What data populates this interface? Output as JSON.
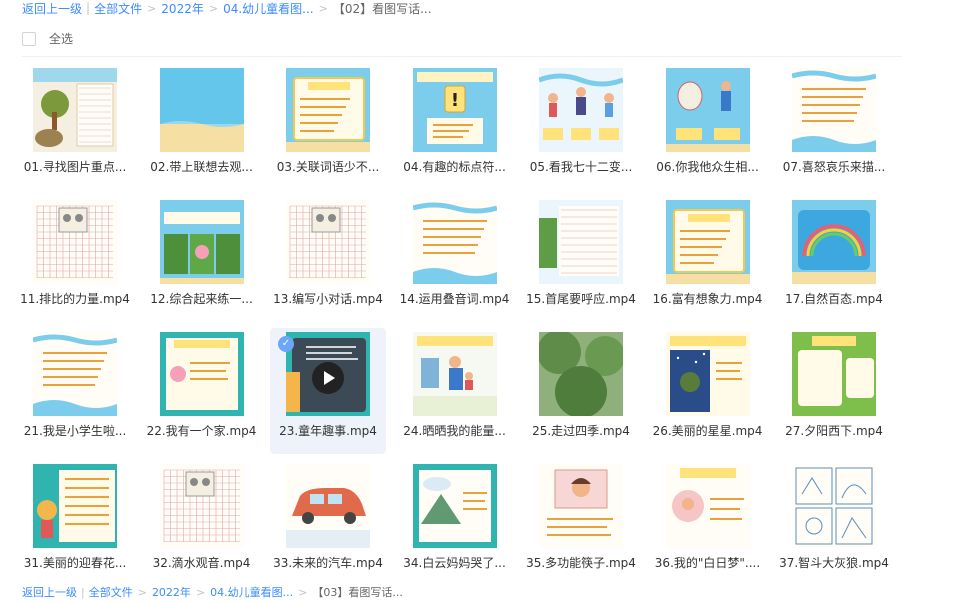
{
  "breadcrumb_top": {
    "back": "返回上一级",
    "items": [
      "全部文件",
      "2022年",
      "04.幼儿童看图..."
    ],
    "current": "【02】看图写话..."
  },
  "select_all_label": "全选",
  "files": [
    {
      "name": "01.寻找图片重点...",
      "thumb": "tree-rock"
    },
    {
      "name": "02.带上联想去观...",
      "thumb": "sea-beach"
    },
    {
      "name": "03.关联词语少不...",
      "thumb": "text-card"
    },
    {
      "name": "04.有趣的标点符...",
      "thumb": "exclaim"
    },
    {
      "name": "05.看我七十二变...",
      "thumb": "dancers"
    },
    {
      "name": "06.你我他众生相...",
      "thumb": "figures"
    },
    {
      "name": "07.喜怒哀乐来描...",
      "thumb": "text-sea"
    },
    {
      "name": "11.排比的力量.mp4",
      "thumb": "grid-writing"
    },
    {
      "name": "12.综合起来练一...",
      "thumb": "lotus"
    },
    {
      "name": "13.编写小对话.mp4",
      "thumb": "grid-writing"
    },
    {
      "name": "14.运用叠音词.mp4",
      "thumb": "text-sea"
    },
    {
      "name": "15.首尾要呼应.mp4",
      "thumb": "text-green"
    },
    {
      "name": "16.富有想象力.mp4",
      "thumb": "text-card"
    },
    {
      "name": "17.自然百态.mp4",
      "thumb": "rainbow"
    },
    {
      "name": "21.我是小学生啦...",
      "thumb": "text-sea"
    },
    {
      "name": "22.我有一个家.mp4",
      "thumb": "card-green"
    },
    {
      "name": "23.童年趣事.mp4",
      "thumb": "dark-card"
    },
    {
      "name": "24.晒晒我的能量...",
      "thumb": "family"
    },
    {
      "name": "25.走过四季.mp4",
      "thumb": "nature"
    },
    {
      "name": "26.美丽的星星.mp4",
      "thumb": "night"
    },
    {
      "name": "27.夕阳西下.mp4",
      "thumb": "green-card"
    },
    {
      "name": "31.美丽的迎春花...",
      "thumb": "flower-text"
    },
    {
      "name": "32.滴水观音.mp4",
      "thumb": "grid-writing"
    },
    {
      "name": "33.未来的汽车.mp4",
      "thumb": "car"
    },
    {
      "name": "34.白云妈妈哭了...",
      "thumb": "clouds"
    },
    {
      "name": "35.多功能筷子.mp4",
      "thumb": "girl"
    },
    {
      "name": "36.我的\"白日梦\"....",
      "thumb": "dream"
    },
    {
      "name": "37.智斗大灰狼.mp4",
      "thumb": "comic"
    }
  ],
  "breadcrumb_bottom": {
    "back": "返回上一级",
    "items": [
      "全部文件",
      "2022年",
      "04.幼儿童看图..."
    ],
    "current": "【03】看图写话..."
  }
}
